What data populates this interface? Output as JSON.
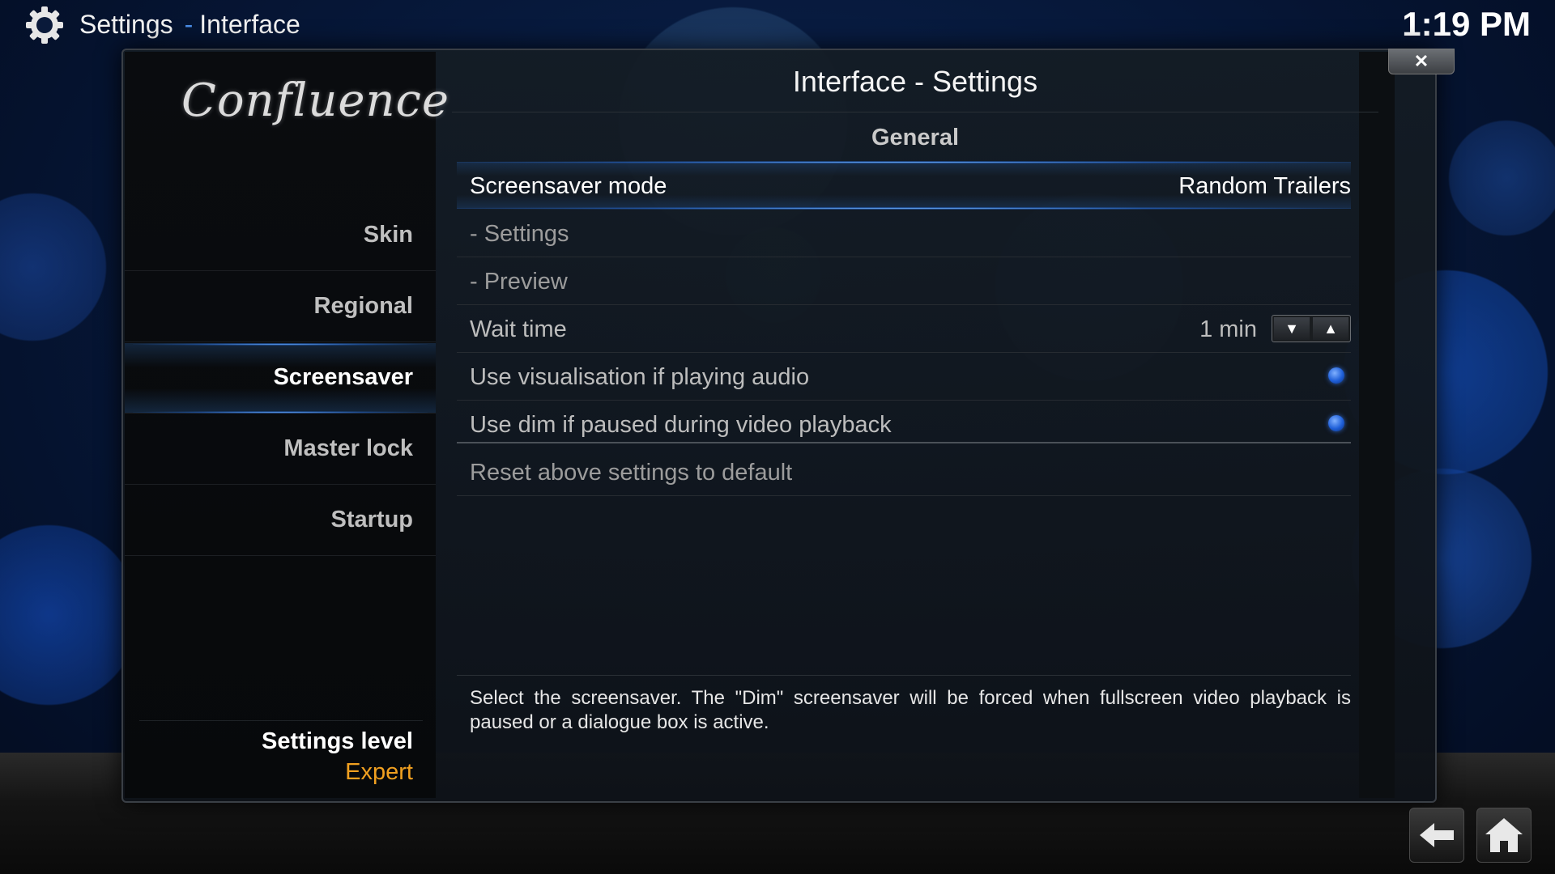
{
  "header": {
    "app": "Settings",
    "separator": "-",
    "section": "Interface",
    "clock": "1:19 PM"
  },
  "sidebar": {
    "logo": "Confluence",
    "items": [
      {
        "label": "Skin",
        "active": false
      },
      {
        "label": "Regional",
        "active": false
      },
      {
        "label": "Screensaver",
        "active": true
      },
      {
        "label": "Master lock",
        "active": false
      },
      {
        "label": "Startup",
        "active": false
      }
    ],
    "settings_level_label": "Settings level",
    "settings_level_value": "Expert"
  },
  "dialog": {
    "title": "Interface - Settings",
    "close_icon": "close-icon",
    "section_heading": "General",
    "rows": {
      "screensaver_mode": {
        "label": "Screensaver mode",
        "value": "Random Trailers"
      },
      "settings": {
        "label": "- Settings"
      },
      "preview": {
        "label": "- Preview"
      },
      "wait_time": {
        "label": "Wait time",
        "value": "1 min"
      },
      "use_visualisation": {
        "label": "Use visualisation if playing audio",
        "enabled": true
      },
      "use_dim": {
        "label": "Use dim if paused during video playback",
        "enabled": true
      },
      "reset": {
        "label": "Reset above settings to default"
      }
    },
    "description": "Select the screensaver. The \"Dim\" screensaver will be forced when fullscreen video playback is paused or a dialogue box is active."
  },
  "colors": {
    "accent_blue": "#4a8de8",
    "level_orange": "#f0a020",
    "background_dark": "#061636"
  },
  "nav": {
    "back_icon": "back-arrow-icon",
    "home_icon": "home-icon"
  }
}
